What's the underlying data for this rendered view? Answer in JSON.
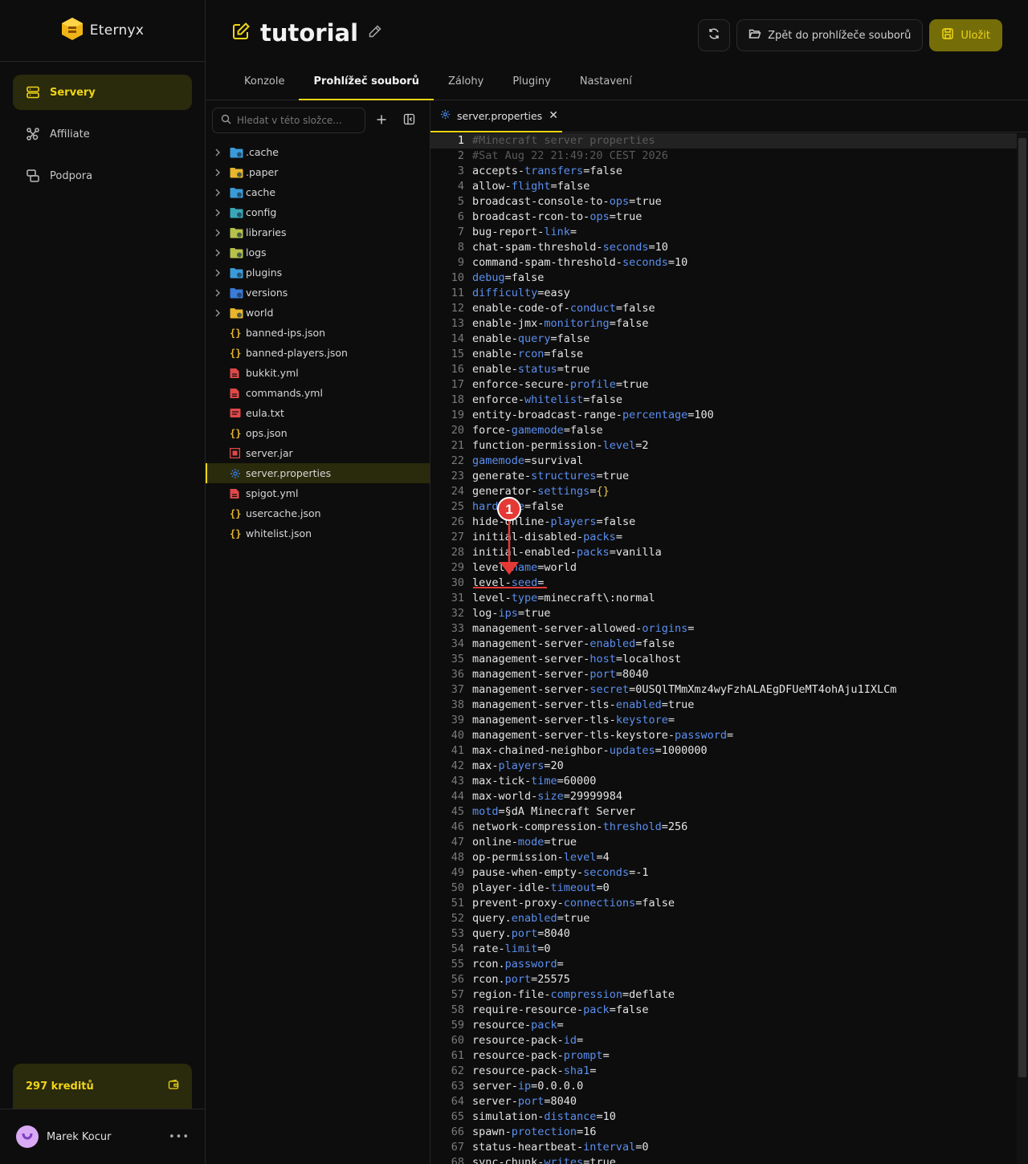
{
  "brand": {
    "name": "Eternyx"
  },
  "nav": [
    {
      "label": "Servery",
      "icon": "server-icon",
      "active": true
    },
    {
      "label": "Affiliate",
      "icon": "affiliate-icon",
      "active": false
    },
    {
      "label": "Podpora",
      "icon": "support-icon",
      "active": false
    }
  ],
  "credits": {
    "label": "297 kreditů"
  },
  "user": {
    "name": "Marek Kocur"
  },
  "header": {
    "title": "tutorial",
    "back_label": "Zpět do prohlížeče souborů",
    "save_label": "Uložit"
  },
  "tabs": [
    {
      "label": "Konzole",
      "active": false
    },
    {
      "label": "Prohlížeč souborů",
      "active": true
    },
    {
      "label": "Zálohy",
      "active": false
    },
    {
      "label": "Pluginy",
      "active": false
    },
    {
      "label": "Nastavení",
      "active": false
    }
  ],
  "search": {
    "placeholder": "Hledat v této složce..."
  },
  "files": [
    {
      "name": ".cache",
      "type": "folder",
      "icon": "folder-cache-icon",
      "color": "#3b9bd9"
    },
    {
      "name": ".paper",
      "type": "folder",
      "icon": "folder-icon",
      "color": "#e8b62c"
    },
    {
      "name": "cache",
      "type": "folder",
      "icon": "folder-cache-icon",
      "color": "#3b9bd9"
    },
    {
      "name": "config",
      "type": "folder",
      "icon": "folder-config-icon",
      "color": "#39a7b8"
    },
    {
      "name": "libraries",
      "type": "folder",
      "icon": "folder-lib-icon",
      "color": "#b7c04a"
    },
    {
      "name": "logs",
      "type": "folder",
      "icon": "folder-logs-icon",
      "color": "#b7c04a"
    },
    {
      "name": "plugins",
      "type": "folder",
      "icon": "folder-plugins-icon",
      "color": "#3b9bd9"
    },
    {
      "name": "versions",
      "type": "folder",
      "icon": "folder-versions-icon",
      "color": "#3b7bd9"
    },
    {
      "name": "world",
      "type": "folder",
      "icon": "folder-icon",
      "color": "#e8b62c"
    },
    {
      "name": "banned-ips.json",
      "type": "file",
      "icon": "json-icon",
      "color": "#e8b62c"
    },
    {
      "name": "banned-players.json",
      "type": "file",
      "icon": "json-icon",
      "color": "#e8b62c"
    },
    {
      "name": "bukkit.yml",
      "type": "file",
      "icon": "yaml-icon",
      "color": "#e04848"
    },
    {
      "name": "commands.yml",
      "type": "file",
      "icon": "yaml-icon",
      "color": "#e04848"
    },
    {
      "name": "eula.txt",
      "type": "file",
      "icon": "txt-icon",
      "color": "#e04848"
    },
    {
      "name": "ops.json",
      "type": "file",
      "icon": "json-icon",
      "color": "#e8b62c"
    },
    {
      "name": "server.jar",
      "type": "file",
      "icon": "jar-icon",
      "color": "#e04848"
    },
    {
      "name": "server.properties",
      "type": "file",
      "icon": "gear-icon",
      "color": "#3b7bd9",
      "selected": true
    },
    {
      "name": "spigot.yml",
      "type": "file",
      "icon": "yaml-icon",
      "color": "#e04848"
    },
    {
      "name": "usercache.json",
      "type": "file",
      "icon": "json-icon",
      "color": "#e8b62c"
    },
    {
      "name": "whitelist.json",
      "type": "file",
      "icon": "json-icon",
      "color": "#e8b62c"
    }
  ],
  "editor": {
    "tab_label": "server.properties",
    "annotation_number": "1",
    "lines": [
      "#Minecraft server properties",
      "#Sat Aug 22 21:49:20 CEST 2026",
      "accepts-transfers=false",
      "allow-flight=false",
      "broadcast-console-to-ops=true",
      "broadcast-rcon-to-ops=true",
      "bug-report-link=",
      "chat-spam-threshold-seconds=10",
      "command-spam-threshold-seconds=10",
      "debug=false",
      "difficulty=easy",
      "enable-code-of-conduct=false",
      "enable-jmx-monitoring=false",
      "enable-query=false",
      "enable-rcon=false",
      "enable-status=true",
      "enforce-secure-profile=true",
      "enforce-whitelist=false",
      "entity-broadcast-range-percentage=100",
      "force-gamemode=false",
      "function-permission-level=2",
      "gamemode=survival",
      "generate-structures=true",
      "generator-settings={}",
      "hardcore=false",
      "hide-online-players=false",
      "initial-disabled-packs=",
      "initial-enabled-packs=vanilla",
      "level-name=world",
      "level-seed=",
      "level-type=minecraft\\:normal",
      "log-ips=true",
      "management-server-allowed-origins=",
      "management-server-enabled=false",
      "management-server-host=localhost",
      "management-server-port=8040",
      "management-server-secret=0USQlTMmXmz4wyFzhALAEgDFUeMT4ohAju1IXLCm",
      "management-server-tls-enabled=true",
      "management-server-tls-keystore=",
      "management-server-tls-keystore-password=",
      "max-chained-neighbor-updates=1000000",
      "max-players=20",
      "max-tick-time=60000",
      "max-world-size=29999984",
      "motd=§dA Minecraft Server",
      "network-compression-threshold=256",
      "online-mode=true",
      "op-permission-level=4",
      "pause-when-empty-seconds=-1",
      "player-idle-timeout=0",
      "prevent-proxy-connections=false",
      "query.enabled=true",
      "query.port=8040",
      "rate-limit=0",
      "rcon.password=",
      "rcon.port=25575",
      "region-file-compression=deflate",
      "require-resource-pack=false",
      "resource-pack=",
      "resource-pack-id=",
      "resource-pack-prompt=",
      "resource-pack-sha1=",
      "server-ip=0.0.0.0",
      "server-port=8040",
      "simulation-distance=10",
      "spawn-protection=16",
      "status-heartbeat-interval=0",
      "sync-chunk-writes=true"
    ]
  },
  "colors": {
    "accent": "#f0d516",
    "accent_bg": "#2a2a0c",
    "keyword": "#5b8ff0",
    "annotation": "#e53935"
  }
}
